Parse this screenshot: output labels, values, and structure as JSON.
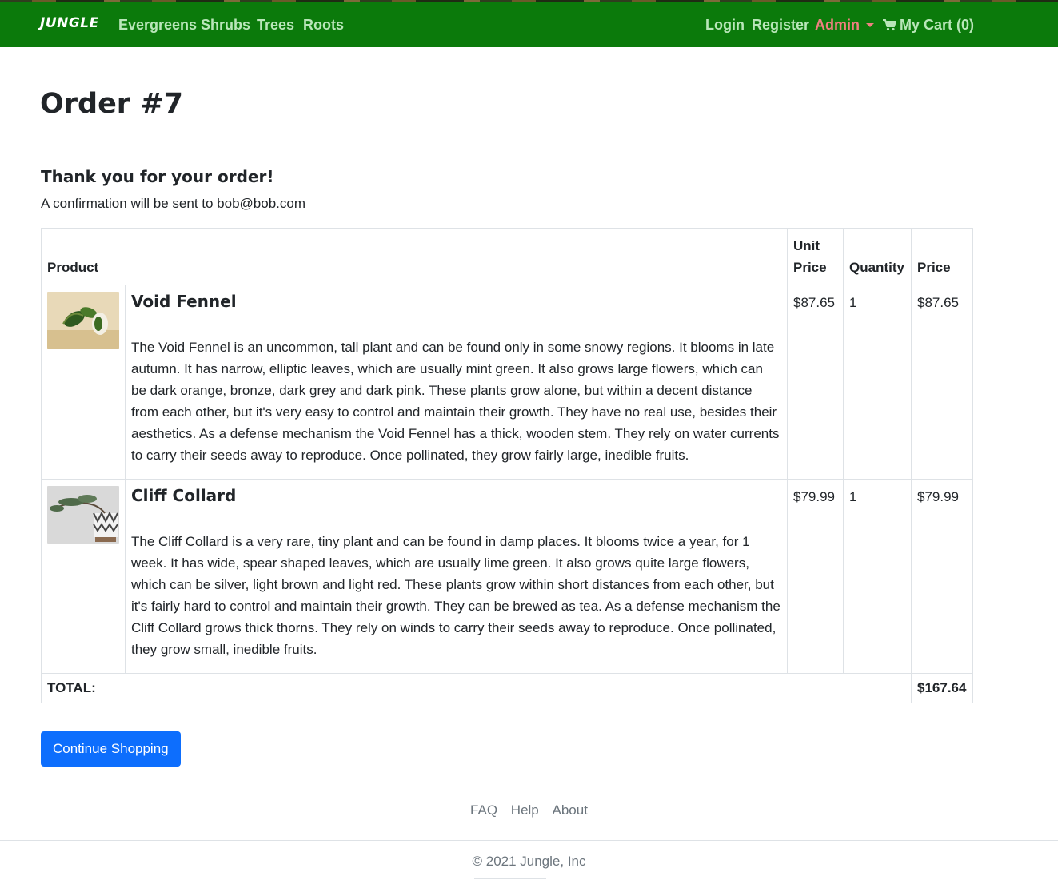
{
  "nav": {
    "brand": "JUNGLE",
    "categories": [
      "Evergreens",
      "Shrubs",
      "Trees",
      "Roots"
    ],
    "login": "Login",
    "register": "Register",
    "admin": "Admin",
    "cart": "My Cart (0)",
    "colors": {
      "background": "#0b7a0b",
      "link": "#b9e6b9",
      "admin": "#f08080"
    }
  },
  "page": {
    "title": "Order #7",
    "thanks": "Thank you for your order!",
    "confirmation": "A confirmation will be sent to bob@bob.com"
  },
  "table": {
    "headers": {
      "product": "Product",
      "unit_price": "Unit Price",
      "quantity": "Quantity",
      "price": "Price"
    },
    "items": [
      {
        "name": "Void Fennel",
        "description": "The Void Fennel is an uncommon, tall plant and can be found only in some snowy regions. It blooms in late autumn. It has narrow, elliptic leaves, which are usually mint green. It also grows large flowers, which can be dark orange, bronze, dark grey and dark pink. These plants grow alone, but within a decent distance from each other, but it's very easy to control and maintain their growth. They have no real use, besides their aesthetics. As a defense mechanism the Void Fennel has a thick, wooden stem. They rely on water currents to carry their seeds away to reproduce. Once pollinated, they grow fairly large, inedible fruits.",
        "unit_price": "$87.65",
        "quantity": "1",
        "price": "$87.65",
        "image_icon": "potted-plant-photo"
      },
      {
        "name": "Cliff Collard",
        "description": "The Cliff Collard is a very rare, tiny plant and can be found in damp places. It blooms twice a year, for 1 week. It has wide, spear shaped leaves, which are usually lime green. It also grows quite large flowers, which can be silver, light brown and light red. These plants grow within short distances from each other, but it's fairly hard to control and maintain their growth. They can be brewed as tea. As a defense mechanism the Cliff Collard grows thick thorns. They rely on winds to carry their seeds away to reproduce. Once pollinated, they grow small, inedible fruits.",
        "unit_price": "$79.99",
        "quantity": "1",
        "price": "$79.99",
        "image_icon": "bonsai-photo"
      }
    ],
    "total_label": "TOTAL:",
    "total_value": "$167.64"
  },
  "actions": {
    "continue": "Continue Shopping",
    "color": "#0d6efd"
  },
  "footer": {
    "links": [
      "FAQ",
      "Help",
      "About"
    ],
    "copyright": "© 2021 Jungle, Inc"
  }
}
